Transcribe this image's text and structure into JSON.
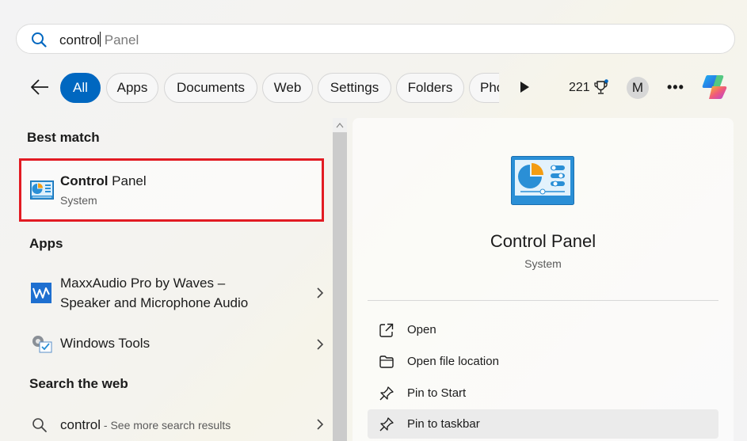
{
  "search": {
    "typed": "control",
    "suggestion": " Panel",
    "icon": "search-icon"
  },
  "filters": {
    "back_icon": "back-arrow-icon",
    "chips": [
      "All",
      "Apps",
      "Documents",
      "Web",
      "Settings",
      "Folders",
      "Pho"
    ],
    "active": "All",
    "more_icon": "play-icon",
    "points": "221",
    "avatar_initial": "M",
    "menu_label": "•••"
  },
  "results": {
    "best_match_heading": "Best match",
    "best_match": {
      "name_bold": "Control",
      "name_rest": " Panel",
      "type": "System"
    },
    "apps_heading": "Apps",
    "apps": [
      {
        "label_line1": "MaxxAudio Pro by Waves –",
        "label_line2": "Speaker and Microphone Audio"
      },
      {
        "label_line1": "Windows Tools",
        "label_line2": ""
      }
    ],
    "web_heading": "Search the web",
    "web_query": "control",
    "web_hint": " - See more search results"
  },
  "detail": {
    "name": "Control Panel",
    "type": "System",
    "actions": [
      {
        "label": "Open",
        "icon": "open-external-icon"
      },
      {
        "label": "Open file location",
        "icon": "folder-icon"
      },
      {
        "label": "Pin to Start",
        "icon": "pin-icon"
      },
      {
        "label": "Pin to taskbar",
        "icon": "pin-icon"
      }
    ]
  },
  "colors": {
    "accent": "#0067c0",
    "highlight_border": "#e21b23"
  }
}
